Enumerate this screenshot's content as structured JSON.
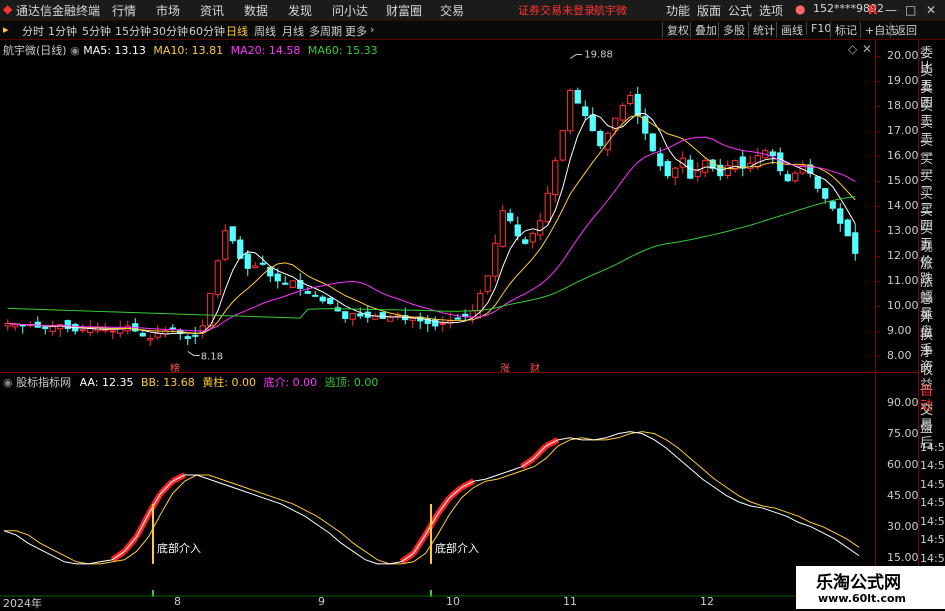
{
  "app": {
    "title": "通达信金融终端",
    "menu": [
      "行情",
      "市场",
      "资讯",
      "数据",
      "发现",
      "问小达",
      "财富圈",
      "交易"
    ],
    "login_notice": "证券交易未登录",
    "stock_name": "航宇微",
    "right_menu": [
      "功能",
      "版面",
      "公式",
      "选项"
    ],
    "user": "152****9892",
    "window_controls": [
      "R",
      "—",
      "□",
      "✕"
    ]
  },
  "toolbar": {
    "periods": [
      "分时",
      "1分钟",
      "5分钟",
      "15分钟",
      "30分钟",
      "60分钟",
      "日线",
      "周线",
      "月线",
      "多周期",
      "更多"
    ],
    "active_period": "日线",
    "right_items": [
      "复权",
      "叠加",
      "多股",
      "统计",
      "画线",
      "F10",
      "+自选",
      "返回"
    ]
  },
  "main_legend": {
    "stock": "航宇微(日线)",
    "ma": [
      {
        "label": "MA5: 13.13",
        "color": "#ffffff"
      },
      {
        "label": "MA10: 13.81",
        "color": "#ffcc33"
      },
      {
        "label": "MA20: 14.58",
        "color": "#ff33ff"
      },
      {
        "label": "MA60: 15.33",
        "color": "#33cc33"
      }
    ],
    "high_label": "19.88",
    "low_label": "8.18",
    "y_ticks": [
      "20.00",
      "19.00",
      "18.00",
      "17.00",
      "16.00",
      "15.00",
      "14.00",
      "13.00",
      "12.00",
      "11.00",
      "10.00",
      "9.00",
      "8.00"
    ],
    "tags": [
      {
        "text": "榜",
        "style": "red"
      },
      {
        "text": "涨",
        "style": "red"
      },
      {
        "text": "财",
        "style": "red"
      }
    ]
  },
  "indicator_legend": {
    "name": "股标指标网",
    "items": [
      {
        "label": "AA: 12.35",
        "color": "#ffffff"
      },
      {
        "label": "BB: 13.68",
        "color": "#ffcc33"
      },
      {
        "label": "黄柱: 0.00",
        "color": "#ffcc33"
      },
      {
        "label": "底介: 0.00",
        "color": "#ff33ff"
      },
      {
        "label": "逃顶: 0.00",
        "color": "#33cc33"
      }
    ],
    "y_ticks": [
      "90.00",
      "75.00",
      "60.00",
      "45.00",
      "30.00",
      "15.00"
    ],
    "signals": [
      "底部介入",
      "底部介入"
    ]
  },
  "dates": [
    "2024年",
    "8",
    "9",
    "10",
    "11",
    "12"
  ],
  "right_panel": {
    "quote_items": [
      "委比",
      "卖五",
      "卖四",
      "卖三",
      "卖二",
      "卖一",
      "买一",
      "买二",
      "买三",
      "买四",
      "买五",
      "现价",
      "涨跌",
      "涨幅",
      "总量",
      "外盘",
      "换手",
      "净资",
      "收益"
    ],
    "bottom_items": [
      "自动",
      "交易",
      "盘后",
      "14:56",
      "14:56",
      "14:56",
      "14:56",
      "14:56",
      "14:56",
      "14:56",
      "14:56"
    ]
  },
  "watermark": {
    "title": "乐淘公式网",
    "url": "www.60lt.com"
  },
  "chart_data": {
    "type": "candlestick",
    "title": "航宇微(日线)",
    "ylim": [
      7.6,
      20.3
    ],
    "high": 19.88,
    "low": 8.18,
    "closes": [
      9.3,
      9.25,
      9.2,
      9.25,
      9.15,
      9.1,
      9.2,
      9.25,
      9.1,
      9.0,
      9.05,
      9.1,
      9.15,
      9.05,
      9.0,
      9.1,
      9.2,
      9.0,
      8.8,
      8.7,
      8.9,
      9.0,
      9.1,
      8.9,
      8.7,
      8.8,
      9.2,
      10.5,
      11.8,
      13.0,
      12.6,
      11.9,
      11.5,
      11.6,
      11.7,
      11.2,
      11.0,
      10.9,
      11.0,
      10.7,
      10.5,
      10.4,
      10.2,
      10.1,
      9.8,
      9.5,
      9.7,
      9.6,
      9.55,
      9.6,
      9.5,
      9.55,
      9.6,
      9.45,
      9.5,
      9.4,
      9.3,
      9.2,
      9.3,
      9.4,
      9.5,
      9.6,
      9.8,
      10.5,
      11.2,
      12.5,
      13.8,
      13.4,
      12.8,
      12.5,
      12.9,
      13.4,
      14.5,
      15.8,
      17.0,
      18.6,
      18.1,
      17.6,
      17.0,
      16.4,
      16.9,
      17.5,
      18.0,
      18.4,
      17.6,
      16.9,
      16.2,
      15.6,
      15.2,
      15.5,
      15.9,
      15.1,
      15.4,
      15.8,
      15.5,
      15.2,
      15.6,
      15.8,
      15.5,
      15.7,
      16.0,
      16.2,
      16.0,
      15.4,
      15.0,
      15.3,
      15.6,
      15.3,
      14.7,
      14.3,
      13.9,
      13.3,
      12.8,
      12.1
    ],
    "series": [
      {
        "name": "MA5",
        "color": "#ffffff"
      },
      {
        "name": "MA10",
        "color": "#ffcc33"
      },
      {
        "name": "MA20",
        "color": "#ff33ff"
      },
      {
        "name": "MA60",
        "color": "#33cc33"
      }
    ],
    "indicator": {
      "ylim": [
        10,
        100
      ],
      "AA": [
        28,
        26,
        22,
        19,
        16,
        13,
        12,
        12,
        13,
        14,
        18,
        25,
        36,
        46,
        52,
        55,
        55,
        53,
        51,
        49,
        47,
        45,
        43,
        41,
        38,
        35,
        31,
        27,
        22,
        18,
        14,
        12,
        12,
        13,
        17,
        26,
        36,
        44,
        49,
        52,
        53,
        55,
        57,
        59,
        63,
        69,
        72,
        73,
        72,
        72,
        73,
        75,
        76,
        75,
        72,
        68,
        63,
        58,
        53,
        49,
        45,
        42,
        40,
        39,
        37,
        35,
        32,
        30,
        27,
        24,
        20,
        16
      ]
    }
  }
}
